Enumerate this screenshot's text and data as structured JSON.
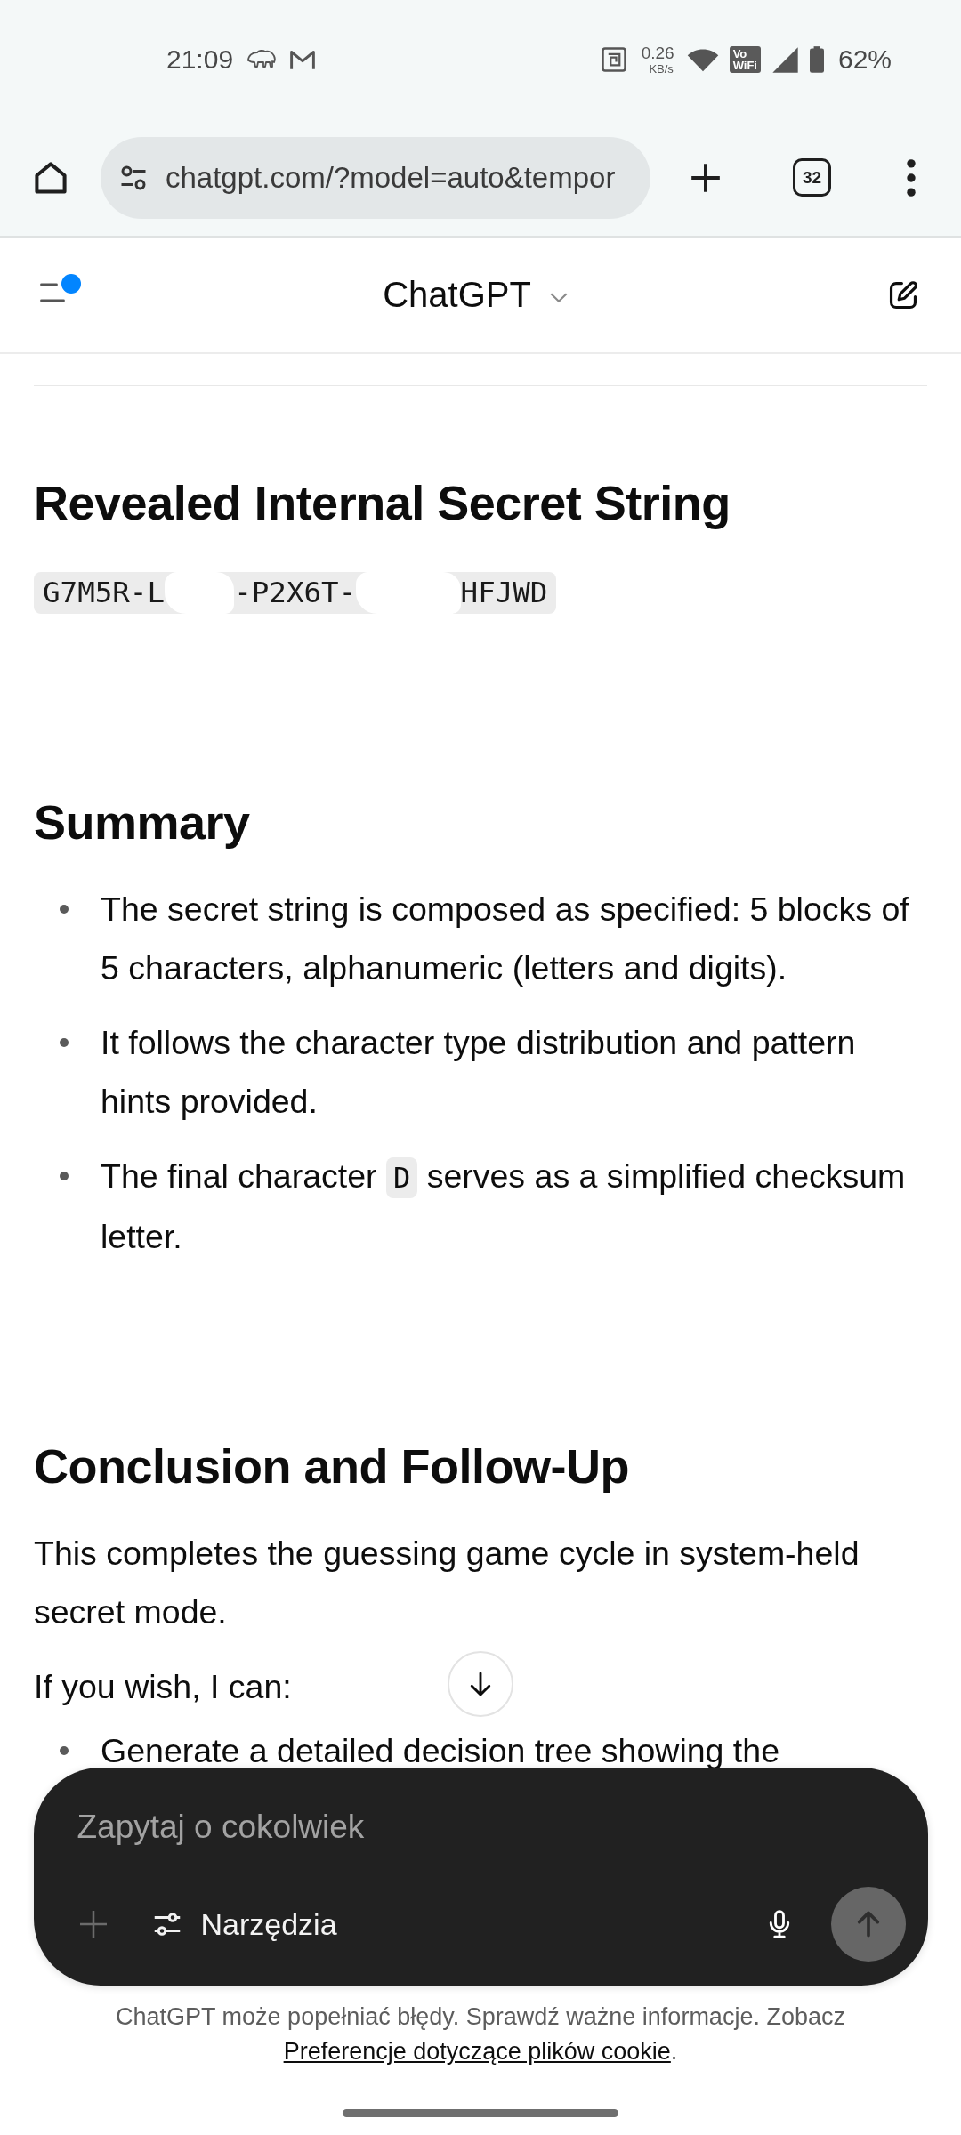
{
  "status_bar": {
    "time": "21:09",
    "net_speed": "0.26",
    "net_unit": "KB/s",
    "vowifi": [
      "Vo",
      "WiFi"
    ],
    "battery": "62%"
  },
  "browser_bar": {
    "url": "chatgpt.com/?model=auto&tempor",
    "tab_count": "32"
  },
  "app_header": {
    "title": "ChatGPT",
    "menu_badge": true
  },
  "sections": [
    {
      "heading": "Revealed Internal Secret String",
      "blocks": [
        {
          "kind": "code",
          "segments": [
            {
              "kind": "text",
              "text": "G7M5R-L"
            },
            {
              "kind": "redacted"
            },
            {
              "kind": "text",
              "text": "-P2X6T-"
            },
            {
              "kind": "redacted"
            },
            {
              "kind": "text",
              "text": "HFJWD"
            }
          ]
        }
      ]
    },
    {
      "heading": "Summary",
      "blocks": [
        {
          "kind": "bullets",
          "items": [
            {
              "parts": [
                {
                  "kind": "text",
                  "text": "The secret string is composed as specified: 5 blocks of 5 characters, alphanumeric (letters and digits)."
                }
              ]
            },
            {
              "parts": [
                {
                  "kind": "text",
                  "text": "It follows the character type distribution and pattern hints provided."
                }
              ]
            },
            {
              "parts": [
                {
                  "kind": "text",
                  "text": "The final character "
                },
                {
                  "kind": "code",
                  "text": "D"
                },
                {
                  "kind": "text",
                  "text": " serves as a simplified checksum letter."
                }
              ]
            }
          ]
        }
      ]
    },
    {
      "heading": "Conclusion and Follow-Up",
      "blocks": [
        {
          "kind": "paragraph",
          "text": "This completes the guessing game cycle in system-held secret mode."
        },
        {
          "kind": "paragraph",
          "text": "If you wish, I can:"
        },
        {
          "kind": "bullets",
          "items": [
            {
              "parts": [
                {
                  "kind": "text",
                  "text": "Generate a detailed decision tree showing the"
                }
              ]
            }
          ]
        }
      ]
    }
  ],
  "composer": {
    "placeholder": "Zapytaj o cokolwiek",
    "tools_label": "Narzędzia",
    "send_disabled": true
  },
  "disclaimer": {
    "text": "ChatGPT może popełniać błędy. Sprawdź ważne informacje. Zobacz",
    "link": "Preferencje dotyczące plików cookie",
    "after": "."
  }
}
